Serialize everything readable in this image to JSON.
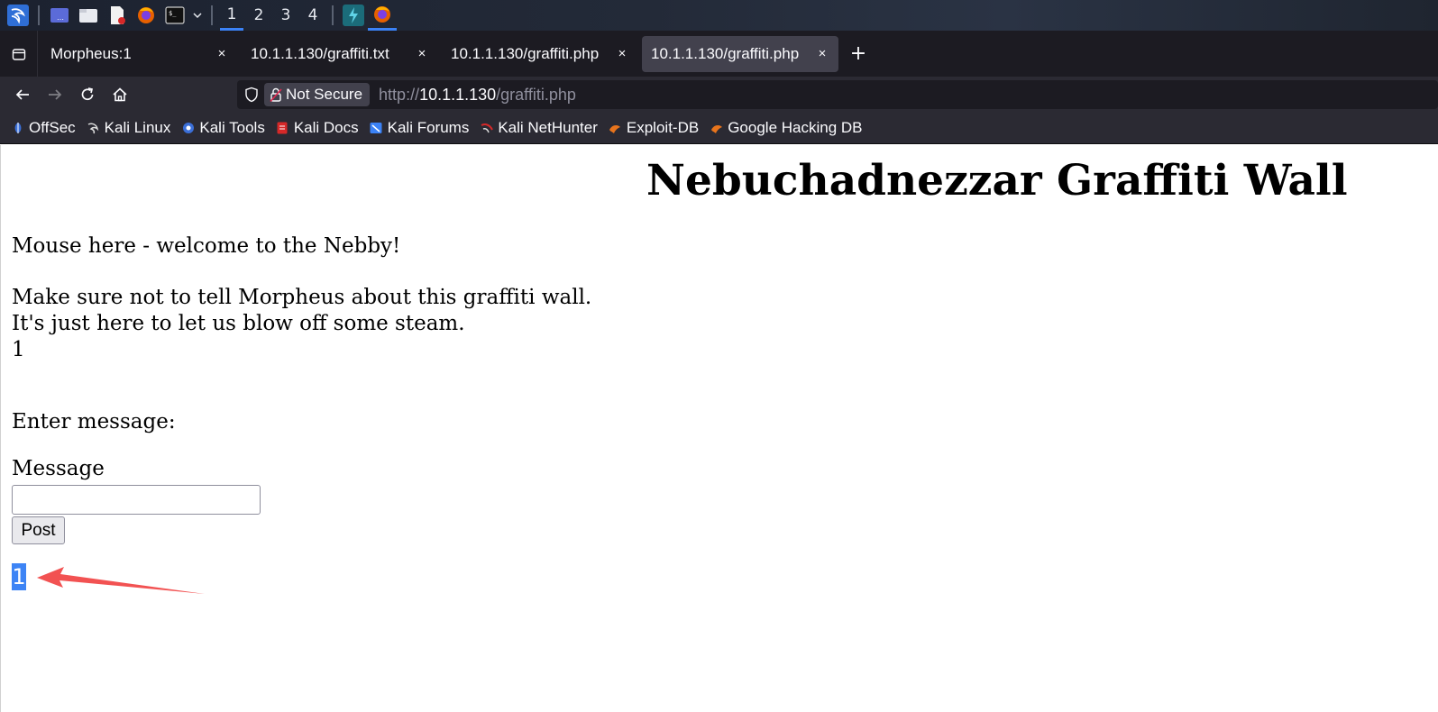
{
  "taskbar": {
    "workspaces": [
      "1",
      "2",
      "3",
      "4"
    ],
    "active_workspace": "1",
    "icons": [
      "kali-menu-icon",
      "desktop-icon",
      "file-manager-icon",
      "text-editor-icon",
      "firefox-icon",
      "terminal-icon",
      "chevron-down-icon",
      "app-icon",
      "firefox-icon"
    ]
  },
  "tabs": [
    {
      "title": "Morpheus:1",
      "active": false
    },
    {
      "title": "10.1.1.130/graffiti.txt",
      "active": false
    },
    {
      "title": "10.1.1.130/graffiti.php",
      "active": false
    },
    {
      "title": "10.1.1.130/graffiti.php",
      "active": true
    }
  ],
  "tab_close_glyph": "×",
  "new_tab_glyph": "+",
  "navbar": {
    "security_label": "Not Secure",
    "url_prefix": "http://",
    "url_host": "10.1.1.130",
    "url_path": "/graffiti.php"
  },
  "bookmarks": [
    {
      "label": "OffSec",
      "icon": "offsec-icon",
      "color": "#3b6fd8"
    },
    {
      "label": "Kali Linux",
      "icon": "kali-icon",
      "color": "#cccccc"
    },
    {
      "label": "Kali Tools",
      "icon": "kali-tools-icon",
      "color": "#3b6fd8"
    },
    {
      "label": "Kali Docs",
      "icon": "kali-docs-icon",
      "color": "#d62828"
    },
    {
      "label": "Kali Forums",
      "icon": "kali-forums-icon",
      "color": "#3b82f6"
    },
    {
      "label": "Kali NetHunter",
      "icon": "nethunter-icon",
      "color": "#d62828"
    },
    {
      "label": "Exploit-DB",
      "icon": "exploit-db-icon",
      "color": "#e8741c"
    },
    {
      "label": "Google Hacking DB",
      "icon": "ghdb-icon",
      "color": "#e8741c"
    }
  ],
  "page": {
    "heading": "Nebuchadnezzar Graffiti Wall",
    "line1": "Mouse here - welcome to the Nebby!",
    "line2": "Make sure not to tell Morpheus about this graffiti wall.",
    "line3": "It's just here to let us blow off some steam.",
    "line4": "1",
    "enter_message": "Enter message:",
    "message_label": "Message",
    "message_value": "",
    "post_label": "Post",
    "output_value": "1"
  },
  "colors": {
    "selection": "#3d84f5",
    "annotation_arrow": "#f25252",
    "active_indicator": "#3b82f6"
  }
}
